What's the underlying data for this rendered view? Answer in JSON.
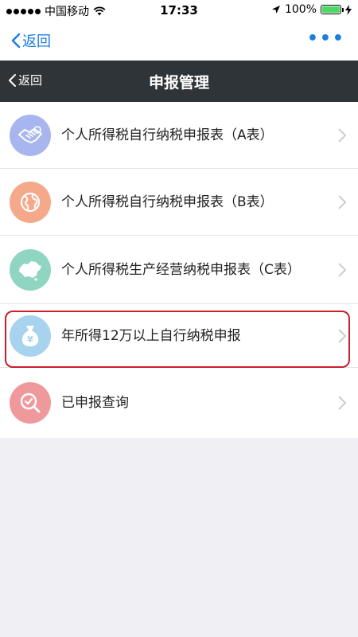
{
  "status_bar": {
    "carrier": "中国移动",
    "time": "17:33",
    "battery": "100%",
    "battery_level": 1.0
  },
  "app_nav": {
    "back_label": "返回",
    "more_label": "•••"
  },
  "header": {
    "back_label": "返回",
    "title": "申报管理"
  },
  "menu": {
    "items": [
      {
        "label": "个人所得税自行纳税申报表（A表）",
        "icon": "handshake-icon",
        "icon_color": "#a7b6ee"
      },
      {
        "label": "个人所得税自行纳税申报表（B表）",
        "icon": "globe-icon",
        "icon_color": "#f4a98a"
      },
      {
        "label": "个人所得税生产经营纳税申报表（C表）",
        "icon": "china-map-icon",
        "icon_color": "#8fd5c2"
      },
      {
        "label": "年所得12万以上自行纳税申报",
        "icon": "money-bag-icon",
        "icon_color": "#a8d3ef"
      },
      {
        "label": "已申报查询",
        "icon": "search-check-icon",
        "icon_color": "#f0999c"
      }
    ]
  },
  "colors": {
    "accent_blue": "#1a7ee0",
    "header_bg": "#2f3438",
    "highlight_red": "#c8202c"
  }
}
